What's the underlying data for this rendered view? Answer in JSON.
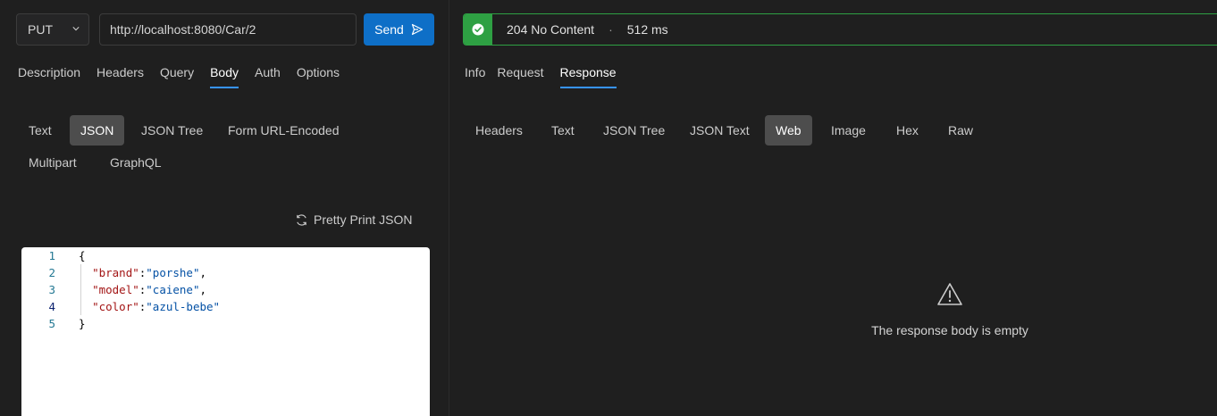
{
  "request": {
    "method": "PUT",
    "url": "http://localhost:8080/Car/2",
    "send_label": "Send"
  },
  "request_tabs": [
    "Description",
    "Headers",
    "Query",
    "Body",
    "Auth",
    "Options"
  ],
  "active_request_tab": "Body",
  "body_types": [
    "Text",
    "JSON",
    "JSON Tree",
    "Form URL-Encoded",
    "Multipart",
    "GraphQL"
  ],
  "active_body_type": "JSON",
  "pretty_print_label": "Pretty Print JSON",
  "editor": {
    "line_numbers": [
      "1",
      "2",
      "3",
      "4",
      "5"
    ],
    "current_line": "4",
    "lines": [
      {
        "text": "{"
      },
      {
        "key": "\"brand\"",
        "value": "\"porshe\"",
        "trail": ","
      },
      {
        "key": "\"model\"",
        "value": "\"caiene\"",
        "trail": ","
      },
      {
        "key": "\"color\"",
        "value": "\"azul-bebe\"",
        "trail": ""
      },
      {
        "text": "}"
      }
    ]
  },
  "response": {
    "status": "204 No Content",
    "separator": "·",
    "time": "512 ms",
    "tabs": [
      "Info",
      "Request",
      "Response"
    ],
    "active_tab": "Response",
    "view_types": [
      "Headers",
      "Text",
      "JSON Tree",
      "JSON Text",
      "Web",
      "Image",
      "Hex",
      "Raw"
    ],
    "active_view_type": "Web",
    "empty_message": "The response body is empty"
  },
  "colors": {
    "accent": "#0e6fc7",
    "success": "#2ea043",
    "tab_underline": "#3794ff"
  }
}
